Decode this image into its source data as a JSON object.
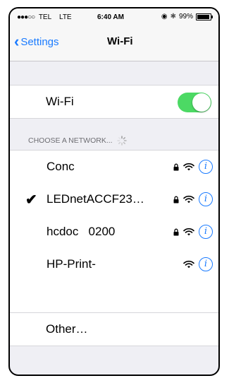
{
  "status_bar": {
    "signal_dots": "●●●○○",
    "carrier": "TEL",
    "network_type": "LTE",
    "time": "6:40 AM",
    "battery": "99%"
  },
  "nav": {
    "back_label": "Settings",
    "title": "Wi-Fi"
  },
  "wifi": {
    "label": "Wi-Fi",
    "enabled": true,
    "toggle_color": "#4cd964"
  },
  "networks_header": "CHOOSE A NETWORK...",
  "networks": [
    {
      "name": "Conc",
      "connected": false,
      "secured": true
    },
    {
      "name": "LEDnetACCF23…",
      "connected": true,
      "secured": true
    },
    {
      "name": "hcdoc   0200",
      "connected": false,
      "secured": true
    },
    {
      "name": "HP-Print-",
      "connected": false,
      "secured": false
    }
  ],
  "other_label": "Other…",
  "colors": {
    "accent": "#1a7bff"
  }
}
